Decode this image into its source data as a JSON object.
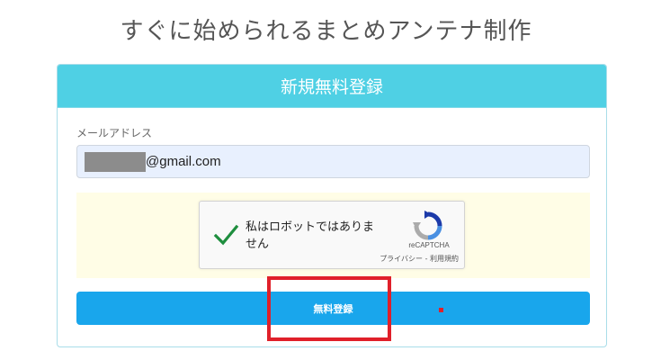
{
  "page": {
    "title": "すぐに始められるまとめアンテナ制作"
  },
  "form": {
    "header": "新規無料登録",
    "email_label": "メールアドレス",
    "email_value": "@gmail.com",
    "recaptcha": {
      "label": "私はロボットではありません",
      "brand": "reCAPTCHA",
      "links": "プライバシー - 利用規約",
      "checked": true
    },
    "submit_label": "無料登録"
  },
  "colors": {
    "header_bg": "#4fd0e4",
    "button_bg": "#19a6ec",
    "captcha_area_bg": "#fffde6",
    "highlight": "#e0202a",
    "check": "#1e8e3e"
  },
  "icons": {
    "check": "check-icon",
    "recaptcha": "recaptcha-icon"
  }
}
